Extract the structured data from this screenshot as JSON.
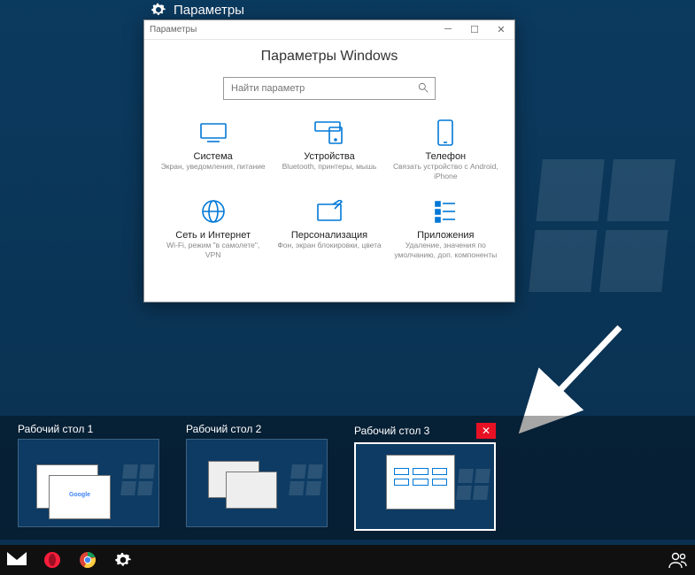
{
  "taskview": {
    "window_label": "Параметры"
  },
  "settings_window": {
    "titlebar_text": "Параметры",
    "heading": "Параметры Windows",
    "search_placeholder": "Найти параметр",
    "tiles": [
      {
        "title": "Система",
        "sub": "Экран, уведомления, питание"
      },
      {
        "title": "Устройства",
        "sub": "Bluetooth, принтеры, мышь"
      },
      {
        "title": "Телефон",
        "sub": "Связать устройство с Android, iPhone"
      },
      {
        "title": "Сеть и Интернет",
        "sub": "Wi-Fi, режим \"в самолете\", VPN"
      },
      {
        "title": "Персонализация",
        "sub": "Фон, экран блокировки, цвета"
      },
      {
        "title": "Приложения",
        "sub": "Удаление, значения по умолчанию, доп. компоненты"
      }
    ]
  },
  "virtual_desktops": [
    {
      "label": "Рабочий стол 1",
      "active": false
    },
    {
      "label": "Рабочий стол 2",
      "active": false
    },
    {
      "label": "Рабочий стол 3",
      "active": true
    }
  ],
  "taskbar": {
    "items": [
      "mail",
      "opera",
      "chrome",
      "settings"
    ],
    "right_items": [
      "people"
    ]
  },
  "colors": {
    "accent": "#0078d7",
    "close_red": "#e81123"
  }
}
